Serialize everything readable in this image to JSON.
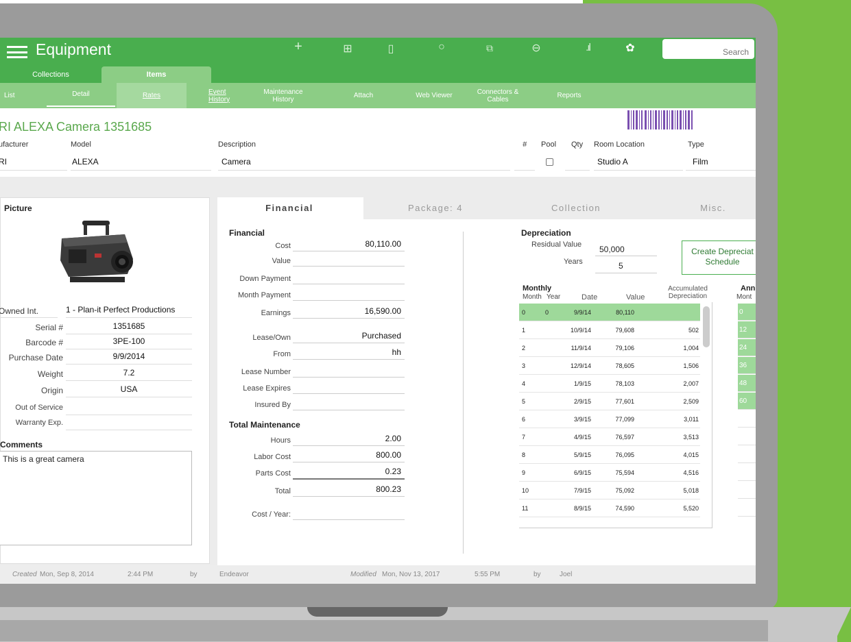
{
  "app": {
    "title": "Equipment",
    "search_placeholder": "Search"
  },
  "toolbar_icons": [
    "plus-icon",
    "add-record-icon",
    "trash-icon",
    "search-icon",
    "duplicate-icon",
    "minus-icon",
    "chart-icon",
    "gear-icon"
  ],
  "tabs_top": {
    "collections": "Collections",
    "items": "Items"
  },
  "tabs_sub": [
    "List",
    "Detail",
    "Rates",
    "Event History",
    "Maintenance History",
    "Attach",
    "Web Viewer",
    "Connectors & Cables",
    "Reports"
  ],
  "record": {
    "title": "RI ALEXA Camera 1351685",
    "labels": {
      "manufacturer": "ufacturer",
      "model": "Model",
      "description": "Description",
      "num": "#",
      "pool": "Pool",
      "qty": "Qty",
      "room": "Room Location",
      "type": "Type"
    },
    "values": {
      "manufacturer": "RI",
      "model": "ALEXA",
      "description": "Camera",
      "room": "Studio A",
      "type": "Film"
    }
  },
  "picture_panel": {
    "heading": "Picture",
    "fields": [
      {
        "label": "Owned Int.",
        "value": "1 - Plan-it Perfect Productions"
      },
      {
        "label": "Serial #",
        "value": "1351685"
      },
      {
        "label": "Barcode #",
        "value": "3PE-100"
      },
      {
        "label": "Purchase Date",
        "value": "9/9/2014"
      },
      {
        "label": "Weight",
        "value": "7.2"
      },
      {
        "label": "Origin",
        "value": "USA"
      },
      {
        "label": "Out of Service",
        "value": ""
      },
      {
        "label": "Warranty Exp.",
        "value": ""
      }
    ],
    "comments_label": "Comments",
    "comments": "This is a great camera"
  },
  "detail_tabs": [
    "Financial",
    "Package: 4",
    "Collection",
    "Misc."
  ],
  "financial": {
    "heading": "Financial",
    "rows": [
      {
        "label": "Cost",
        "value": "80,110.00"
      },
      {
        "label": "Value",
        "value": ""
      },
      {
        "label": "Down Payment",
        "value": ""
      },
      {
        "label": "Month Payment",
        "value": ""
      },
      {
        "label": "Earnings",
        "value": "16,590.00"
      },
      {
        "label": "Lease/Own",
        "value": "Purchased"
      },
      {
        "label": "From",
        "value": "hh"
      },
      {
        "label": "Lease Number",
        "value": ""
      },
      {
        "label": "Lease Expires",
        "value": ""
      },
      {
        "label": "Insured By",
        "value": ""
      }
    ],
    "maint_heading": "Total Maintenance",
    "maint_rows": [
      {
        "label": "Hours",
        "value": "2.00"
      },
      {
        "label": "Labor Cost",
        "value": "800.00"
      },
      {
        "label": "Parts Cost",
        "value": "0.23"
      },
      {
        "label": "Total",
        "value": "800.23"
      },
      {
        "label": "Cost / Year:",
        "value": ""
      }
    ]
  },
  "depreciation": {
    "heading": "Depreciation",
    "residual_label": "Residual Value",
    "residual": "50,000",
    "years_label": "Years",
    "years": "5",
    "button": "Create Depreciat Schedule",
    "monthly_label": "Monthly",
    "col_month": "Month",
    "col_year": "Year",
    "col_date": "Date",
    "col_value": "Value",
    "col_accum": "Accumulated Depreciation",
    "annual_label": "Ann",
    "annual_sub": "Mont",
    "rows": [
      {
        "m": "0",
        "y": "0",
        "date": "9/9/14",
        "value": "80,110",
        "acc": ""
      },
      {
        "m": "1",
        "y": "",
        "date": "10/9/14",
        "value": "79,608",
        "acc": "502"
      },
      {
        "m": "2",
        "y": "",
        "date": "11/9/14",
        "value": "79,106",
        "acc": "1,004"
      },
      {
        "m": "3",
        "y": "",
        "date": "12/9/14",
        "value": "78,605",
        "acc": "1,506"
      },
      {
        "m": "4",
        "y": "",
        "date": "1/9/15",
        "value": "78,103",
        "acc": "2,007"
      },
      {
        "m": "5",
        "y": "",
        "date": "2/9/15",
        "value": "77,601",
        "acc": "2,509"
      },
      {
        "m": "6",
        "y": "",
        "date": "3/9/15",
        "value": "77,099",
        "acc": "3,011"
      },
      {
        "m": "7",
        "y": "",
        "date": "4/9/15",
        "value": "76,597",
        "acc": "3,513"
      },
      {
        "m": "8",
        "y": "",
        "date": "5/9/15",
        "value": "76,095",
        "acc": "4,015"
      },
      {
        "m": "9",
        "y": "",
        "date": "6/9/15",
        "value": "75,594",
        "acc": "4,516"
      },
      {
        "m": "10",
        "y": "",
        "date": "7/9/15",
        "value": "75,092",
        "acc": "5,018"
      },
      {
        "m": "11",
        "y": "",
        "date": "8/9/15",
        "value": "74,590",
        "acc": "5,520"
      }
    ],
    "annual": [
      "0",
      "12",
      "24",
      "36",
      "48",
      "60"
    ]
  },
  "footer": {
    "created_label": "Created",
    "created_date": "Mon, Sep 8, 2014",
    "created_time": "2:44 PM",
    "by1": "by",
    "created_by": "Endeavor",
    "modified_label": "Modified",
    "modified_date": "Mon, Nov 13, 2017",
    "modified_time": "5:55 PM",
    "by2": "by",
    "modified_by": "Joel"
  },
  "colors": {
    "green": "#49ae4e",
    "light_green": "#8ccd85",
    "bg_green": "#78bf43"
  }
}
